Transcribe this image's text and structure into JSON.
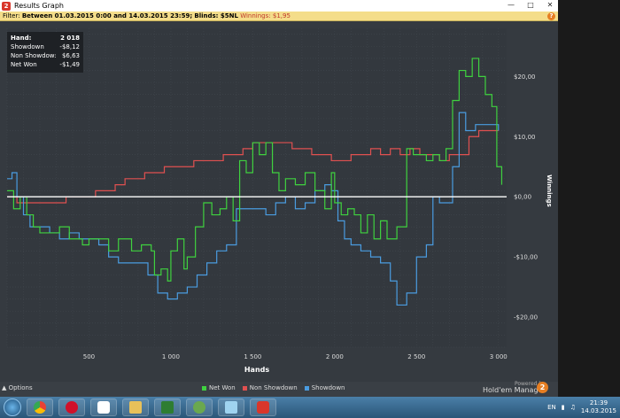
{
  "window": {
    "title": "Results Graph"
  },
  "filter": {
    "prefix": "Filter:",
    "range": "Between 01.03.2015 0:00 and 14.03.2015 23:59;",
    "blinds": "Blinds: $5NL",
    "winnings": "Winnings: $1,95"
  },
  "stats": {
    "hand_label": "Hand:",
    "hand_value": "2 018",
    "showdown_label": "Showdown",
    "showdown_value": "-$8,12",
    "nonshowdown_label": "Non Showdow:",
    "nonshowdown_value": "$6,63",
    "netwon_label": "Net Won",
    "netwon_value": "-$1,49"
  },
  "footer": {
    "options_label": "Options",
    "powered_by": "Powered by",
    "brand": "Hold'em Manager",
    "brand_num": "2"
  },
  "taskbar": {
    "lang": "EN",
    "time": "21:39",
    "date": "14.03.2015"
  },
  "chart_data": {
    "type": "line",
    "xlabel": "Hands",
    "ylabel": "Winnings",
    "xlim": [
      0,
      3050
    ],
    "ylim": [
      -25,
      28
    ],
    "x_ticks": [
      500,
      1000,
      1500,
      2000,
      2500,
      3000
    ],
    "x_tick_labels": [
      "500",
      "1 000",
      "1 500",
      "2 000",
      "2 500",
      "3 000"
    ],
    "y_ticks": [
      20,
      10,
      0,
      -10,
      -20
    ],
    "y_tick_labels": [
      "$20,00",
      "$10,00",
      "$0,00",
      "-$10,00",
      "-$20,00"
    ],
    "legend_position": "bottom",
    "series": [
      {
        "name": "Net Won",
        "color": "#3fd13f",
        "x": [
          0,
          40,
          80,
          120,
          160,
          200,
          260,
          320,
          380,
          420,
          460,
          500,
          560,
          620,
          680,
          760,
          820,
          880,
          900,
          940,
          980,
          1000,
          1040,
          1080,
          1100,
          1150,
          1200,
          1250,
          1300,
          1340,
          1380,
          1420,
          1460,
          1500,
          1540,
          1580,
          1620,
          1660,
          1700,
          1760,
          1820,
          1880,
          1940,
          1980,
          2000,
          2040,
          2080,
          2120,
          2160,
          2200,
          2240,
          2280,
          2320,
          2380,
          2440,
          2480,
          2520,
          2560,
          2600,
          2640,
          2680,
          2720,
          2760,
          2800,
          2840,
          2880,
          2920,
          2960,
          2990,
          3020
        ],
        "y": [
          1,
          -2,
          0,
          -3,
          -5,
          -6,
          -6,
          -5,
          -7,
          -7,
          -8,
          -7,
          -7,
          -9,
          -7,
          -9,
          -8,
          -9,
          -13,
          -12,
          -14,
          -9,
          -7,
          -12,
          -10,
          -5,
          -1,
          -3,
          -2,
          0,
          -4,
          6,
          4,
          9,
          7,
          9,
          4,
          1,
          3,
          2,
          4,
          1,
          -2,
          4,
          -1,
          -3,
          -2,
          -3,
          -6,
          -3,
          -7,
          -4,
          -7,
          -5,
          8,
          7,
          7,
          6,
          7,
          6,
          8,
          16,
          21,
          20,
          23,
          20,
          17,
          15,
          5,
          2
        ]
      },
      {
        "name": "Non Showdown",
        "color": "#e05050",
        "x": [
          0,
          60,
          120,
          180,
          240,
          300,
          360,
          420,
          480,
          540,
          600,
          660,
          720,
          780,
          840,
          900,
          960,
          1020,
          1080,
          1140,
          1200,
          1260,
          1320,
          1380,
          1440,
          1500,
          1560,
          1620,
          1680,
          1740,
          1800,
          1860,
          1920,
          1980,
          2040,
          2100,
          2160,
          2220,
          2280,
          2340,
          2400,
          2460,
          2520,
          2580,
          2640,
          2700,
          2760,
          2820,
          2880,
          2940,
          3000
        ],
        "y": [
          0,
          -1,
          -1,
          -1,
          -1,
          -1,
          0,
          0,
          0,
          1,
          1,
          2,
          3,
          3,
          4,
          4,
          5,
          5,
          5,
          6,
          6,
          6,
          7,
          7,
          8,
          9,
          9,
          9,
          9,
          8,
          8,
          7,
          7,
          6,
          6,
          7,
          7,
          8,
          7,
          8,
          7,
          8,
          7,
          7,
          6,
          7,
          7,
          10,
          11,
          11,
          11
        ]
      },
      {
        "name": "Showdown",
        "color": "#4a9ce0",
        "x": [
          0,
          30,
          60,
          100,
          140,
          200,
          260,
          320,
          380,
          440,
          500,
          560,
          620,
          680,
          740,
          800,
          860,
          920,
          980,
          1040,
          1100,
          1160,
          1220,
          1280,
          1340,
          1400,
          1460,
          1520,
          1580,
          1640,
          1700,
          1760,
          1820,
          1880,
          1940,
          1980,
          2020,
          2060,
          2100,
          2160,
          2220,
          2280,
          2340,
          2380,
          2440,
          2500,
          2560,
          2600,
          2640,
          2680,
          2720,
          2760,
          2800,
          2860,
          2920,
          2960,
          3000
        ],
        "y": [
          3,
          4,
          0,
          -3,
          -5,
          -5,
          -6,
          -7,
          -6,
          -7,
          -7,
          -8,
          -10,
          -11,
          -11,
          -11,
          -13,
          -16,
          -17,
          -16,
          -15,
          -13,
          -11,
          -9,
          -8,
          -2,
          -2,
          -2,
          -3,
          -1,
          0,
          -2,
          -1,
          1,
          2,
          1,
          -4,
          -7,
          -8,
          -9,
          -10,
          -11,
          -14,
          -18,
          -16,
          -10,
          -8,
          0,
          -1,
          -1,
          5,
          14,
          11,
          12,
          12,
          12,
          11
        ]
      }
    ]
  }
}
